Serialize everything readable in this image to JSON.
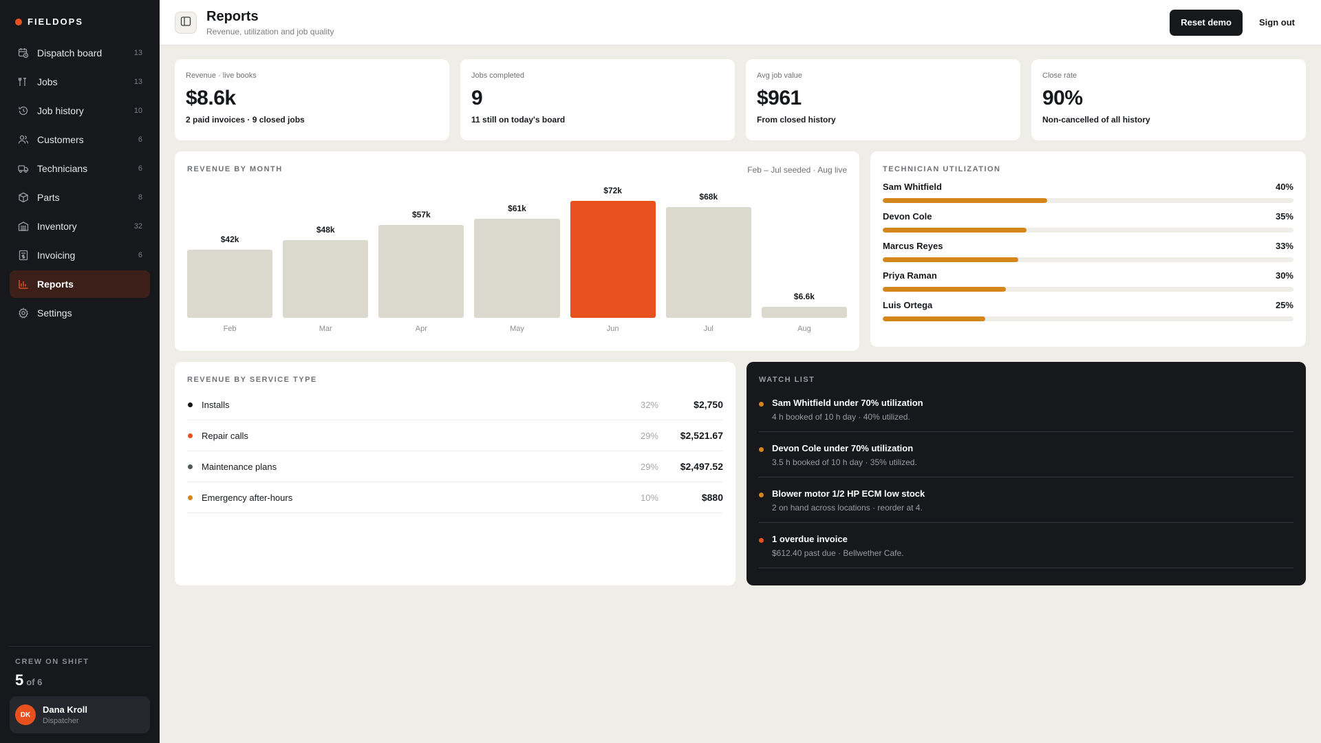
{
  "brand": {
    "name": "FIELDOPS",
    "accent": "#e8501e"
  },
  "sidebar": {
    "items": [
      {
        "label": "Dispatch board",
        "count": "13",
        "icon": "calendar-clock-icon"
      },
      {
        "label": "Jobs",
        "count": "13",
        "icon": "tools-icon"
      },
      {
        "label": "Job history",
        "count": "10",
        "icon": "history-icon"
      },
      {
        "label": "Customers",
        "count": "6",
        "icon": "users-icon"
      },
      {
        "label": "Technicians",
        "count": "6",
        "icon": "truck-icon"
      },
      {
        "label": "Parts",
        "count": "8",
        "icon": "box-icon"
      },
      {
        "label": "Inventory",
        "count": "32",
        "icon": "warehouse-icon"
      },
      {
        "label": "Invoicing",
        "count": "6",
        "icon": "invoice-icon"
      },
      {
        "label": "Reports",
        "count": "",
        "icon": "bar-chart-icon",
        "active": true
      },
      {
        "label": "Settings",
        "count": "",
        "icon": "gear-icon"
      }
    ],
    "crew": {
      "label": "CREW ON SHIFT",
      "count": "5",
      "of": "of 6"
    },
    "user": {
      "initials": "DK",
      "name": "Dana Kroll",
      "role": "Dispatcher"
    }
  },
  "header": {
    "title": "Reports",
    "subtitle": "Revenue, utilization and job quality",
    "reset_label": "Reset demo",
    "signout_label": "Sign out"
  },
  "kpis": [
    {
      "label": "Revenue · live books",
      "value": "$8.6k",
      "sub": "2 paid invoices · 9 closed jobs"
    },
    {
      "label": "Jobs completed",
      "value": "9",
      "sub": "11 still on today's board"
    },
    {
      "label": "Avg job value",
      "value": "$961",
      "sub": "From closed history"
    },
    {
      "label": "Close rate",
      "value": "90%",
      "sub": "Non-cancelled of all history"
    }
  ],
  "revenue_by_month": {
    "title": "REVENUE BY MONTH",
    "note": "Feb – Jul seeded · Aug live"
  },
  "chart_data": {
    "type": "bar",
    "categories": [
      "Feb",
      "Mar",
      "Apr",
      "May",
      "Jun",
      "Jul",
      "Aug"
    ],
    "values": [
      42,
      48,
      57,
      61,
      72,
      68,
      6.6
    ],
    "labels": [
      "$42k",
      "$48k",
      "$57k",
      "$61k",
      "$72k",
      "$68k",
      "$6.6k"
    ],
    "highlight": "Jun",
    "colors": {
      "default": "#dbd8ce",
      "highlight": "#e8501e"
    },
    "ylim": [
      0,
      72
    ],
    "grid": false
  },
  "utilization": {
    "title": "TECHNICIAN UTILIZATION",
    "fill_color": "#d4861a",
    "rows": [
      {
        "name": "Sam Whitfield",
        "pct_label": "40%",
        "pct": 40
      },
      {
        "name": "Devon Cole",
        "pct_label": "35%",
        "pct": 35
      },
      {
        "name": "Marcus Reyes",
        "pct_label": "33%",
        "pct": 33
      },
      {
        "name": "Priya Raman",
        "pct_label": "30%",
        "pct": 30
      },
      {
        "name": "Luis Ortega",
        "pct_label": "25%",
        "pct": 25
      }
    ]
  },
  "service_types": {
    "title": "REVENUE BY SERVICE TYPE",
    "rows": [
      {
        "name": "Installs",
        "pct": "32%",
        "amount": "$2,750",
        "color": "#16181c"
      },
      {
        "name": "Repair calls",
        "pct": "29%",
        "amount": "$2,521.67",
        "color": "#e8501e"
      },
      {
        "name": "Maintenance plans",
        "pct": "29%",
        "amount": "$2,497.52",
        "color": "#4f5a52"
      },
      {
        "name": "Emergency after-hours",
        "pct": "10%",
        "amount": "$880",
        "color": "#d4861a"
      }
    ]
  },
  "watch_list": {
    "title": "WATCH LIST",
    "items": [
      {
        "title": "Sam Whitfield under 70% utilization",
        "sub": "4 h booked of 10 h day · 40% utilized.",
        "color": "#d4861a"
      },
      {
        "title": "Devon Cole under 70% utilization",
        "sub": "3.5 h booked of 10 h day · 35% utilized.",
        "color": "#d4861a"
      },
      {
        "title": "Blower motor 1/2 HP ECM low stock",
        "sub": "2 on hand across locations · reorder at 4.",
        "color": "#d4861a"
      },
      {
        "title": "1 overdue invoice",
        "sub": "$612.40 past due · Bellwether Cafe.",
        "color": "#e8501e"
      }
    ]
  }
}
